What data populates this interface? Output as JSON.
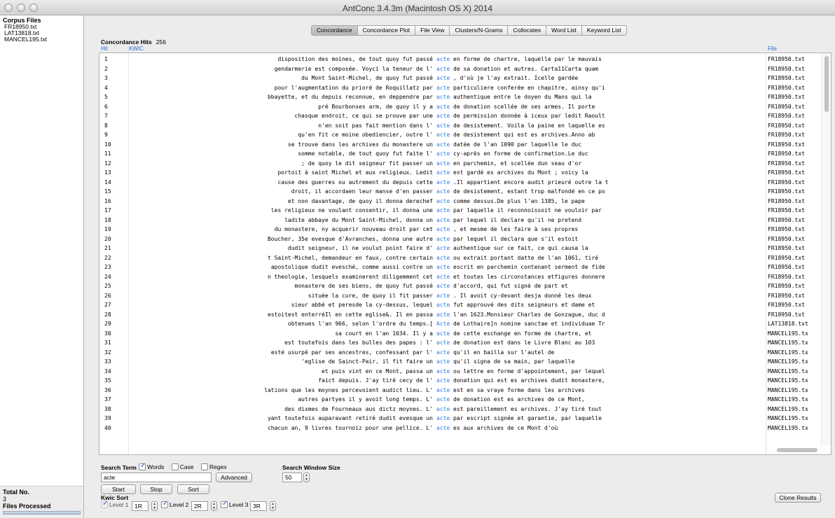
{
  "window": {
    "title": "AntConc 3.4.3m (Macintosh OS X) 2014"
  },
  "corpus": {
    "heading": "Corpus Files",
    "files": [
      "FR18950.txt",
      "LAT13818.txt",
      "MANCEL195.txt"
    ]
  },
  "totals": {
    "total_label": "Total No.",
    "total_value": "3",
    "processed_label": "Files Processed"
  },
  "tabs": [
    "Concordance",
    "Concordance Plot",
    "File View",
    "Clusters/N-Grams",
    "Collocates",
    "Word List",
    "Keyword List"
  ],
  "active_tab": "Concordance",
  "concordance": {
    "hits_label": "Concordance Hits",
    "hits_value": "256",
    "col_hit": "Hit",
    "col_kwic": "KWIC",
    "col_file": "File",
    "rows": [
      {
        "hit": "1",
        "left": "disposition des moines, de tout quoy fut passé",
        "node": "acte",
        "right": "en forme de chartre, laquelle par le mauvais",
        "file": "FR18950.txt"
      },
      {
        "hit": "2",
        "left": "gendarmerie est composée. Voyci la teneur de l'",
        "node": "acte",
        "right": "de sa donation et autres. Carta11Carta quam",
        "file": "FR18950.txt"
      },
      {
        "hit": "3",
        "left": "du Mont Saint-Michel, de quoy fut passé",
        "node": "acte",
        "right": ", d'où je l'ay extrait. Icelle gardée",
        "file": "FR18950.txt"
      },
      {
        "hit": "4",
        "left": "pour l'augmentation du prioré de Roquillatz par",
        "node": "acte",
        "right": "particuliere conferée en chapitre, ainsy qu'i",
        "file": "FR18950.txt"
      },
      {
        "hit": "5",
        "left": "bbayette, et du depuis reconnue, en deppendre par",
        "node": "acte",
        "right": "authentique entre le doyen du Mans qui la",
        "file": "FR18950.txt"
      },
      {
        "hit": "6",
        "left": "pré Bourbonses arm, de quoy il y a",
        "node": "acte",
        "right": "de donation scellée de ses armes. Il porte",
        "file": "FR18950.txt"
      },
      {
        "hit": "7",
        "left": "chasque endroit, ce qui se prouve par une",
        "node": "acte",
        "right": "de permission donnée à iceux par ledit Raoult",
        "file": "FR18950.txt"
      },
      {
        "hit": "8",
        "left": "n'en soit pas fait mention dans l'",
        "node": "acte",
        "right": "de desistement. Voila la paine en laquelle es",
        "file": "FR18950.txt"
      },
      {
        "hit": "9",
        "left": "qu'en fit ce moine obediencier, outre l'",
        "node": "acte",
        "right": "de desistement qui est es archives.Anno ab",
        "file": "FR18950.txt"
      },
      {
        "hit": "10",
        "left": "se trouve dans les archives du monastere un",
        "node": "acte",
        "right": "datée de l'an 1090 par laquelle le duc",
        "file": "FR18950.txt"
      },
      {
        "hit": "11",
        "left": "somme notable, de tout quoy fut faite l'",
        "node": "acte",
        "right": "cy-après en forme de confirmation.Le duc",
        "file": "FR18950.txt"
      },
      {
        "hit": "12",
        "left": "; de quoy le dit seigneur fit passer un",
        "node": "acte",
        "right": "en parchemin, et scellée dun seau d'or",
        "file": "FR18950.txt"
      },
      {
        "hit": "13",
        "left": "portoit à saint Michel et aux religieux. Ledit",
        "node": "acte",
        "right": "est gardé es archives du Mont ; voicy la",
        "file": "FR18950.txt"
      },
      {
        "hit": "14",
        "left": "cause des guerres ou autrement du depuis cette",
        "node": "acte",
        "right": ".Il appartient encore audit prieuré outre la t",
        "file": "FR18950.txt"
      },
      {
        "hit": "15",
        "left": "droit, il accordaen leur manse d'en passer",
        "node": "acte",
        "right": "de desistement, estant trop malfondé en ce po",
        "file": "FR18950.txt"
      },
      {
        "hit": "16",
        "left": "et non davantage, de quoy il donna derechef",
        "node": "acte",
        "right": "comme dessus.De plus l'an 1385, le pape",
        "file": "FR18950.txt"
      },
      {
        "hit": "17",
        "left": "les religieux ne voulant consentir, il donna une",
        "node": "acte",
        "right": "par laquelle il reconnoissoit ne vouloir par",
        "file": "FR18950.txt"
      },
      {
        "hit": "18",
        "left": "ladite abbaye du Mont Saint-Michel, donna un",
        "node": "acte",
        "right": "par lequel il declare qu'il ne pretend",
        "file": "FR18950.txt"
      },
      {
        "hit": "19",
        "left": "du monastere, ny acquerir nouveau droit par cet",
        "node": "acte",
        "right": ", et mesme de les faire à ses propres",
        "file": "FR18950.txt"
      },
      {
        "hit": "20",
        "left": "Boucher, 35e evesque d'Avranches, donna une autre",
        "node": "acte",
        "right": "par lequel il declara que s'il estoit",
        "file": "FR18950.txt"
      },
      {
        "hit": "21",
        "left": "dudit seigneur, il ne voulut point faire d'",
        "node": "acte",
        "right": "authentique sur ce fait, ce qui causa la",
        "file": "FR18950.txt"
      },
      {
        "hit": "22",
        "left": "t Saint-Michel, demandeur en faux, contre certain",
        "node": "acte",
        "right": "ou extrait portant datte de l'an 1061, tiré",
        "file": "FR18950.txt"
      },
      {
        "hit": "23",
        "left": "apostolique dudit evesché, comme aussi contre un",
        "node": "acte",
        "right": "escrit en parchemin contenant serment de fide",
        "file": "FR18950.txt"
      },
      {
        "hit": "24",
        "left": "n theologie, lesquels examinerent diligemment cet",
        "node": "acte",
        "right": "et toutes les circonstances etfigures donnere",
        "file": "FR18950.txt"
      },
      {
        "hit": "25",
        "left": "monastere de ses biens, de quoy fut passé",
        "node": "acte",
        "right": "d'accord, qui fut signé de part et",
        "file": "FR18950.txt"
      },
      {
        "hit": "26",
        "left": "située la cure, de quoy il fit passer",
        "node": "acte",
        "right": ". Il avoit cy-devant desja donné les deux",
        "file": "FR18950.txt"
      },
      {
        "hit": "27",
        "left": "sieur abbé et peresde la cy-dessus, lequel",
        "node": "acte",
        "right": "fut approuvé des dits seigneurs et dame et",
        "file": "FR18950.txt"
      },
      {
        "hit": "28",
        "left": "estoitest enterréIl en cette eglise&. Il en passa",
        "node": "acte",
        "right": "l'an 1623.Monsieur Charles de Gonzague, duc d",
        "file": "FR18950.txt"
      },
      {
        "hit": "29",
        "left": "obtenues l'an 966, selon l'ordre du temps.[",
        "node": "Acte",
        "right": "de Lothaire]n nomine sanctae et individuae Tr",
        "file": "LAT13818.txt"
      },
      {
        "hit": "30",
        "left": "sa court en l'an 1034. Il y a",
        "node": "acte",
        "right": "de cette eschange en forme de chartre, et",
        "file": "MANCEL195.tx"
      },
      {
        "hit": "31",
        "left": "est toutefois dans les bulles des papes : l'",
        "node": "acte",
        "right": "de donation est dans le Livre Blanc au 103",
        "file": "MANCEL195.tx"
      },
      {
        "hit": "32",
        "left": "esté usurpé par ses ancestres, confessant par l'",
        "node": "acte",
        "right": "qu'il en bailla sur l'autel de",
        "file": "MANCEL195.tx"
      },
      {
        "hit": "33",
        "left": "'eglise de Sainct-Pair, il fit faire un",
        "node": "acte",
        "right": "qu'il signa de sa main, par laquelle",
        "file": "MANCEL195.tx"
      },
      {
        "hit": "34",
        "left": "et puis vint en ce Mont, passa un",
        "node": "acte",
        "right": "ou lettre en forme d'appointement, par lequel",
        "file": "MANCEL195.tx"
      },
      {
        "hit": "35",
        "left": "faict depuis. J'ay tiré cecy de l'",
        "node": "acte",
        "right": "donation qui est es archives dudit monastere,",
        "file": "MANCEL195.tx"
      },
      {
        "hit": "36",
        "left": "lations que les moynes percevoient audict lieu. L'",
        "node": "acte",
        "right": "est en sa vraye forme dans les archives",
        "file": "MANCEL195.tx"
      },
      {
        "hit": "37",
        "left": "autres partyes il y avoit long temps. L'",
        "node": "acte",
        "right": "de donation est es archives de ce Mont,",
        "file": "MANCEL195.tx"
      },
      {
        "hit": "38",
        "left": "des dixmes de Fourneaux aus dictz moynes. L'",
        "node": "acte",
        "right": "est pareillement es archives. J'ay tiré tout",
        "file": "MANCEL195.tx"
      },
      {
        "hit": "39",
        "left": "yant toutefois auparavant retiré dudit evesque un",
        "node": "acte",
        "right": "par escript signée et garantie, par laquelle",
        "file": "MANCEL195.tx"
      },
      {
        "hit": "40",
        "left": "chacun an, 9 livres tournoiz pour une pellice. L'",
        "node": "acte",
        "right": "es aux archives de ce Mont d'où",
        "file": "MANCEL195.tx"
      }
    ]
  },
  "search": {
    "term_label": "Search Term",
    "words_label": "Words",
    "words_checked": true,
    "case_label": "Case",
    "case_checked": false,
    "regex_label": "Regex",
    "regex_checked": false,
    "query": "acte",
    "advanced_label": "Advanced",
    "window_label": "Search Window Size",
    "window_value": "50"
  },
  "buttons": {
    "start": "Start",
    "stop": "Stop",
    "sort": "Sort",
    "clone": "Clone Results"
  },
  "kwic_sort": {
    "label": "Kwic Sort",
    "levels": [
      {
        "label": "Level 1",
        "value": "1R",
        "checked": true
      },
      {
        "label": "Level 2",
        "value": "2R",
        "checked": true
      },
      {
        "label": "Level 3",
        "value": "3R",
        "checked": true
      }
    ]
  },
  "colors": {
    "node": "#2a7fe0",
    "header": "#2968d8"
  }
}
